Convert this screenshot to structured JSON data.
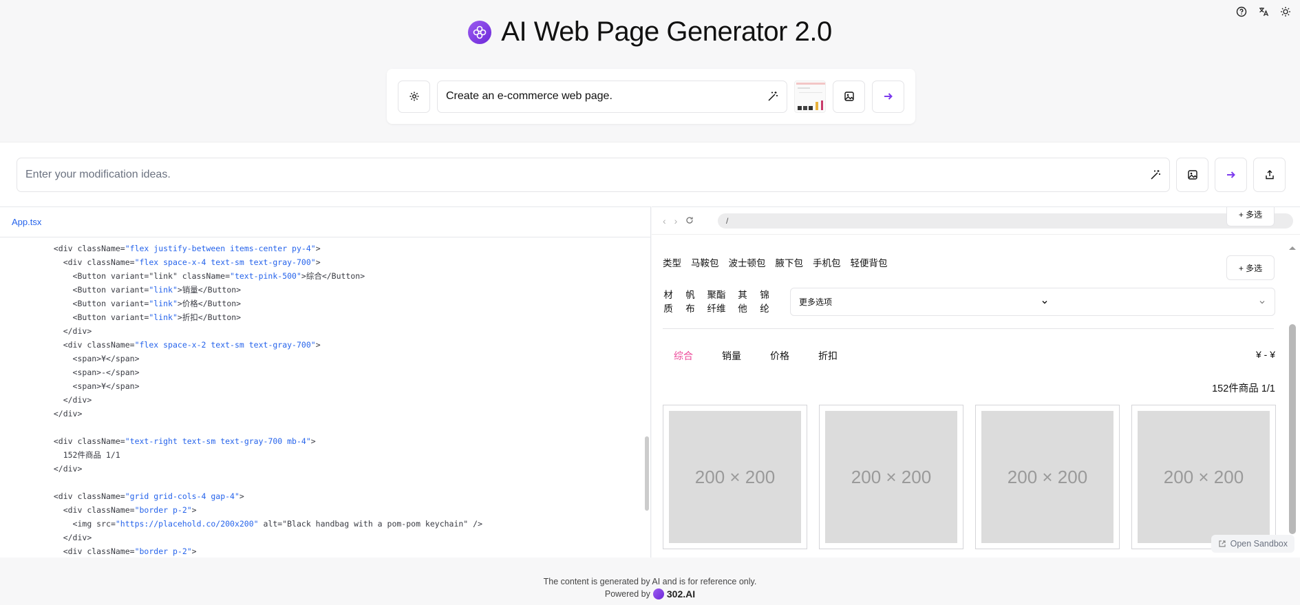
{
  "app": {
    "title": "AI Web Page Generator 2.0"
  },
  "generator": {
    "prompt_value": "Create an e-commerce web page."
  },
  "modify": {
    "placeholder": "Enter your modification ideas."
  },
  "editor": {
    "file_tab": "App.tsx",
    "lines": [
      [
        "  ",
        "<div ",
        "className=",
        "\"flex justify-between items-center py-4\"",
        ">"
      ],
      [
        "    ",
        "<div ",
        "className=",
        "\"flex space-x-4 text-sm text-gray-700\"",
        ">"
      ],
      [
        "      ",
        "<Button ",
        "variant=\"link\" className=",
        "\"text-pink-500\"",
        ">综合</Button>"
      ],
      [
        "      ",
        "<Button ",
        "variant=",
        "\"link\"",
        ">销量</Button>"
      ],
      [
        "      ",
        "<Button ",
        "variant=",
        "\"link\"",
        ">价格</Button>"
      ],
      [
        "      ",
        "<Button ",
        "variant=",
        "\"link\"",
        ">折扣</Button>"
      ],
      [
        "    ",
        "</div>",
        "",
        "",
        ""
      ],
      [
        "    ",
        "<div ",
        "className=",
        "\"flex space-x-2 text-sm text-gray-700\"",
        ">"
      ],
      [
        "      ",
        "<span>",
        "¥",
        "",
        "</span>"
      ],
      [
        "      ",
        "<span>",
        "-",
        "",
        "</span>"
      ],
      [
        "      ",
        "<span>",
        "¥",
        "",
        "</span>"
      ],
      [
        "    ",
        "</div>",
        "",
        "",
        ""
      ],
      [
        "  ",
        "</div>",
        "",
        "",
        ""
      ],
      [
        "",
        "",
        "",
        "",
        ""
      ],
      [
        "  ",
        "<div ",
        "className=",
        "\"text-right text-sm text-gray-700 mb-4\"",
        ">"
      ],
      [
        "    ",
        "152件商品 1/1",
        "",
        "",
        ""
      ],
      [
        "  ",
        "</div>",
        "",
        "",
        ""
      ],
      [
        "",
        "",
        "",
        "",
        ""
      ],
      [
        "  ",
        "<div ",
        "className=",
        "\"grid grid-cols-4 gap-4\"",
        ">"
      ],
      [
        "    ",
        "<div ",
        "className=",
        "\"border p-2\"",
        ">"
      ],
      [
        "      ",
        "<img ",
        "src=",
        "\"https://placehold.co/200x200\"",
        " alt=\"Black handbag with a pom-pom keychain\" />"
      ],
      [
        "    ",
        "</div>",
        "",
        "",
        ""
      ],
      [
        "    ",
        "<div ",
        "className=",
        "\"border p-2\"",
        ">"
      ]
    ]
  },
  "preview": {
    "url": "/",
    "type_label": "类型",
    "types": [
      "马鞍包",
      "波士顿包",
      "腋下包",
      "手机包",
      "轻便背包"
    ],
    "more_top": "+ 多选",
    "more_btn": "+ 多选",
    "materials": [
      "材\n质",
      "帆\n布",
      "聚酯\n纤维",
      "其\n他",
      "锦\n纶"
    ],
    "select_more": "更多选项",
    "sort": [
      "综合",
      "销量",
      "价格",
      "折扣"
    ],
    "price_range": "¥ - ¥",
    "count": "152件商品 1/1",
    "placeholders": [
      "200 × 200",
      "200 × 200",
      "200 × 200",
      "200 × 200"
    ],
    "sandbox_label": "Open Sandbox"
  },
  "footer": {
    "disclaimer": "The content is generated by AI and is for reference only.",
    "powered_by": "Powered by",
    "brand": "302.AI"
  },
  "colors": {
    "accent": "#7c3aed",
    "sort_active": "#ec4899",
    "code_string": "#2563eb"
  }
}
